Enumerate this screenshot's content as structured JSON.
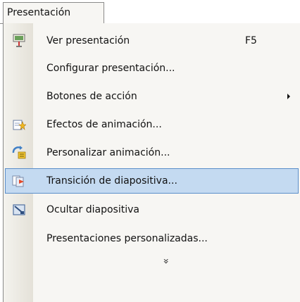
{
  "menu": {
    "title": "Presentación",
    "items": [
      {
        "label": "Ver presentación",
        "shortcut": "F5",
        "icon": "slideshow-screen-icon"
      },
      {
        "label": "Configurar presentación...",
        "shortcut": "",
        "icon": ""
      },
      {
        "label": "Botones de acción",
        "shortcut": "",
        "icon": "",
        "submenu": true
      },
      {
        "label": "Efectos de animación...",
        "shortcut": "",
        "icon": "animation-effects-icon"
      },
      {
        "label": "Personalizar animación...",
        "shortcut": "",
        "icon": "custom-animation-icon"
      },
      {
        "label": "Transición de diapositiva...",
        "shortcut": "",
        "icon": "slide-transition-icon",
        "highlighted": true
      },
      {
        "label": "Ocultar diapositiva",
        "shortcut": "",
        "icon": "hide-slide-icon"
      },
      {
        "label": "Presentaciones personalizadas...",
        "shortcut": "",
        "icon": ""
      }
    ],
    "expand_glyph": "»"
  },
  "colors": {
    "highlight_bg": "#c4daf1",
    "highlight_border": "#5b8ec9",
    "menu_bg": "#f7f6f3"
  }
}
